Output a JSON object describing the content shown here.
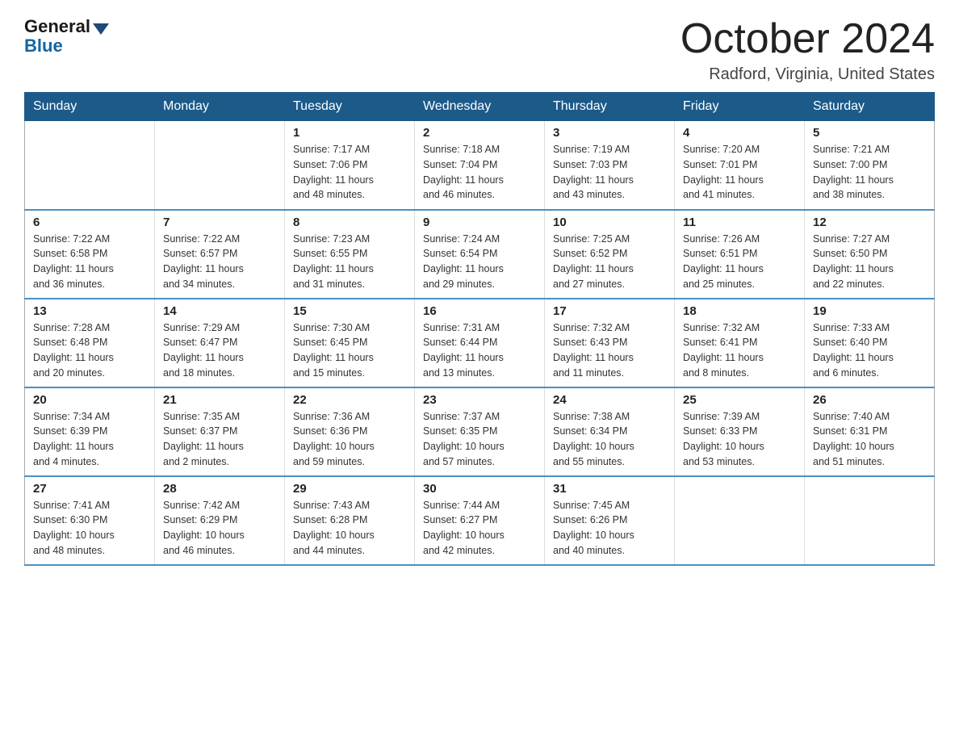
{
  "header": {
    "logo_general": "General",
    "logo_blue": "Blue",
    "month_title": "October 2024",
    "location": "Radford, Virginia, United States"
  },
  "days_of_week": [
    "Sunday",
    "Monday",
    "Tuesday",
    "Wednesday",
    "Thursday",
    "Friday",
    "Saturday"
  ],
  "weeks": [
    [
      {
        "day": "",
        "info": ""
      },
      {
        "day": "",
        "info": ""
      },
      {
        "day": "1",
        "info": "Sunrise: 7:17 AM\nSunset: 7:06 PM\nDaylight: 11 hours\nand 48 minutes."
      },
      {
        "day": "2",
        "info": "Sunrise: 7:18 AM\nSunset: 7:04 PM\nDaylight: 11 hours\nand 46 minutes."
      },
      {
        "day": "3",
        "info": "Sunrise: 7:19 AM\nSunset: 7:03 PM\nDaylight: 11 hours\nand 43 minutes."
      },
      {
        "day": "4",
        "info": "Sunrise: 7:20 AM\nSunset: 7:01 PM\nDaylight: 11 hours\nand 41 minutes."
      },
      {
        "day": "5",
        "info": "Sunrise: 7:21 AM\nSunset: 7:00 PM\nDaylight: 11 hours\nand 38 minutes."
      }
    ],
    [
      {
        "day": "6",
        "info": "Sunrise: 7:22 AM\nSunset: 6:58 PM\nDaylight: 11 hours\nand 36 minutes."
      },
      {
        "day": "7",
        "info": "Sunrise: 7:22 AM\nSunset: 6:57 PM\nDaylight: 11 hours\nand 34 minutes."
      },
      {
        "day": "8",
        "info": "Sunrise: 7:23 AM\nSunset: 6:55 PM\nDaylight: 11 hours\nand 31 minutes."
      },
      {
        "day": "9",
        "info": "Sunrise: 7:24 AM\nSunset: 6:54 PM\nDaylight: 11 hours\nand 29 minutes."
      },
      {
        "day": "10",
        "info": "Sunrise: 7:25 AM\nSunset: 6:52 PM\nDaylight: 11 hours\nand 27 minutes."
      },
      {
        "day": "11",
        "info": "Sunrise: 7:26 AM\nSunset: 6:51 PM\nDaylight: 11 hours\nand 25 minutes."
      },
      {
        "day": "12",
        "info": "Sunrise: 7:27 AM\nSunset: 6:50 PM\nDaylight: 11 hours\nand 22 minutes."
      }
    ],
    [
      {
        "day": "13",
        "info": "Sunrise: 7:28 AM\nSunset: 6:48 PM\nDaylight: 11 hours\nand 20 minutes."
      },
      {
        "day": "14",
        "info": "Sunrise: 7:29 AM\nSunset: 6:47 PM\nDaylight: 11 hours\nand 18 minutes."
      },
      {
        "day": "15",
        "info": "Sunrise: 7:30 AM\nSunset: 6:45 PM\nDaylight: 11 hours\nand 15 minutes."
      },
      {
        "day": "16",
        "info": "Sunrise: 7:31 AM\nSunset: 6:44 PM\nDaylight: 11 hours\nand 13 minutes."
      },
      {
        "day": "17",
        "info": "Sunrise: 7:32 AM\nSunset: 6:43 PM\nDaylight: 11 hours\nand 11 minutes."
      },
      {
        "day": "18",
        "info": "Sunrise: 7:32 AM\nSunset: 6:41 PM\nDaylight: 11 hours\nand 8 minutes."
      },
      {
        "day": "19",
        "info": "Sunrise: 7:33 AM\nSunset: 6:40 PM\nDaylight: 11 hours\nand 6 minutes."
      }
    ],
    [
      {
        "day": "20",
        "info": "Sunrise: 7:34 AM\nSunset: 6:39 PM\nDaylight: 11 hours\nand 4 minutes."
      },
      {
        "day": "21",
        "info": "Sunrise: 7:35 AM\nSunset: 6:37 PM\nDaylight: 11 hours\nand 2 minutes."
      },
      {
        "day": "22",
        "info": "Sunrise: 7:36 AM\nSunset: 6:36 PM\nDaylight: 10 hours\nand 59 minutes."
      },
      {
        "day": "23",
        "info": "Sunrise: 7:37 AM\nSunset: 6:35 PM\nDaylight: 10 hours\nand 57 minutes."
      },
      {
        "day": "24",
        "info": "Sunrise: 7:38 AM\nSunset: 6:34 PM\nDaylight: 10 hours\nand 55 minutes."
      },
      {
        "day": "25",
        "info": "Sunrise: 7:39 AM\nSunset: 6:33 PM\nDaylight: 10 hours\nand 53 minutes."
      },
      {
        "day": "26",
        "info": "Sunrise: 7:40 AM\nSunset: 6:31 PM\nDaylight: 10 hours\nand 51 minutes."
      }
    ],
    [
      {
        "day": "27",
        "info": "Sunrise: 7:41 AM\nSunset: 6:30 PM\nDaylight: 10 hours\nand 48 minutes."
      },
      {
        "day": "28",
        "info": "Sunrise: 7:42 AM\nSunset: 6:29 PM\nDaylight: 10 hours\nand 46 minutes."
      },
      {
        "day": "29",
        "info": "Sunrise: 7:43 AM\nSunset: 6:28 PM\nDaylight: 10 hours\nand 44 minutes."
      },
      {
        "day": "30",
        "info": "Sunrise: 7:44 AM\nSunset: 6:27 PM\nDaylight: 10 hours\nand 42 minutes."
      },
      {
        "day": "31",
        "info": "Sunrise: 7:45 AM\nSunset: 6:26 PM\nDaylight: 10 hours\nand 40 minutes."
      },
      {
        "day": "",
        "info": ""
      },
      {
        "day": "",
        "info": ""
      }
    ]
  ]
}
